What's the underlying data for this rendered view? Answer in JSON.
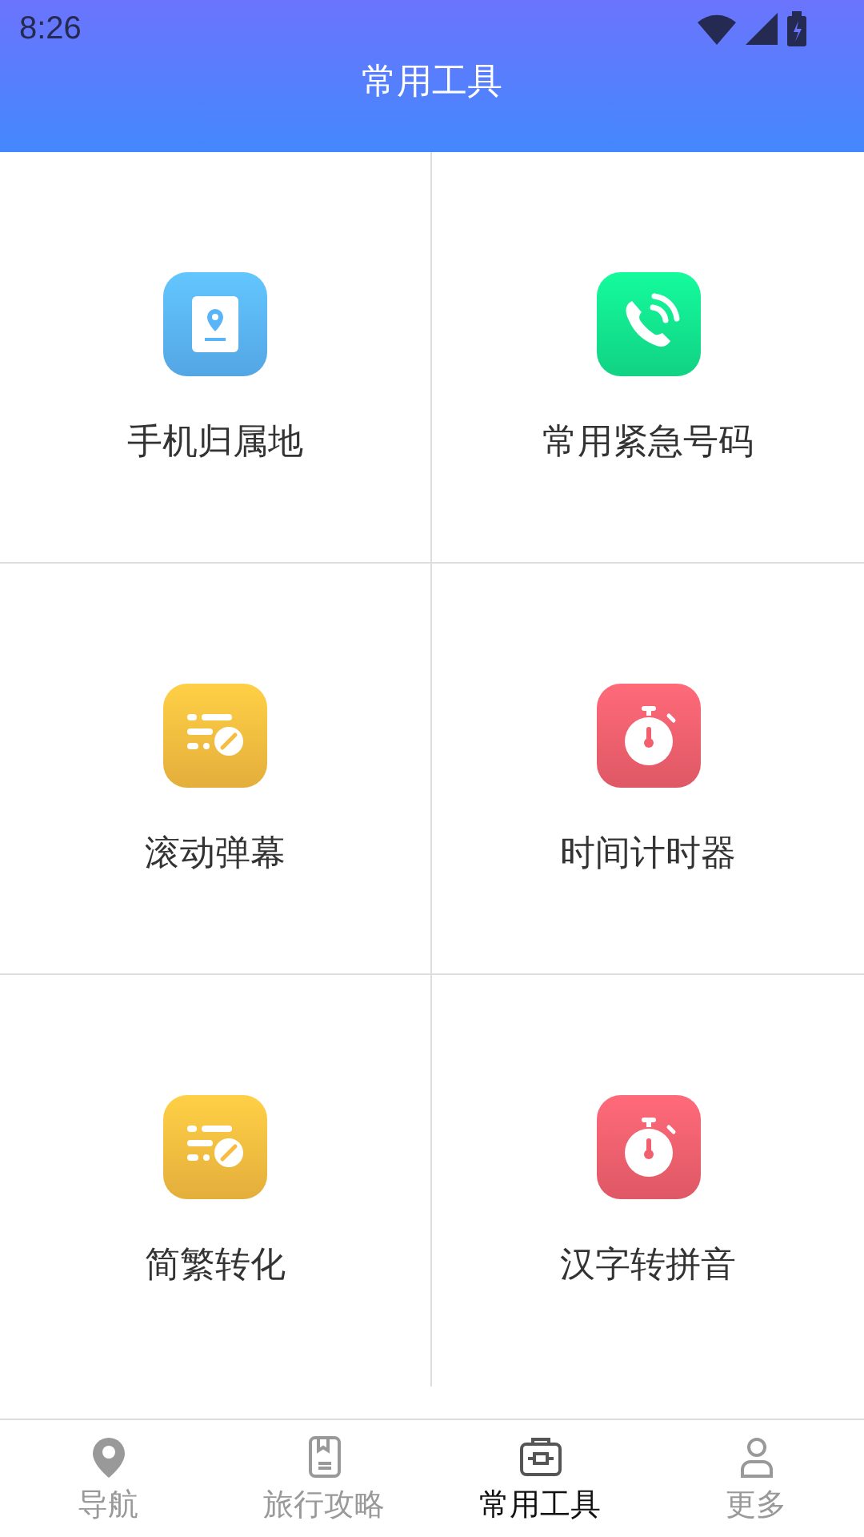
{
  "status_bar": {
    "time": "8:26"
  },
  "header": {
    "title": "常用工具"
  },
  "tools": [
    {
      "label": "手机归属地",
      "kind": "location",
      "color": "#5ab4f8"
    },
    {
      "label": "常用紧急号码",
      "kind": "phone",
      "color": "#12e48e"
    },
    {
      "label": "滚动弹幕",
      "kind": "list",
      "color": "#f8bd40"
    },
    {
      "label": "时间计时器",
      "kind": "timer",
      "color": "#f2606e"
    },
    {
      "label": "简繁转化",
      "kind": "list",
      "color": "#f8bd40"
    },
    {
      "label": "汉字转拼音",
      "kind": "timer",
      "color": "#f2606e"
    }
  ],
  "nav": [
    {
      "label": "导航",
      "kind": "pin",
      "selected": false
    },
    {
      "label": "旅行攻略",
      "kind": "book",
      "selected": false
    },
    {
      "label": "常用工具",
      "kind": "toolbox",
      "selected": true
    },
    {
      "label": "更多",
      "kind": "person",
      "selected": false
    }
  ]
}
